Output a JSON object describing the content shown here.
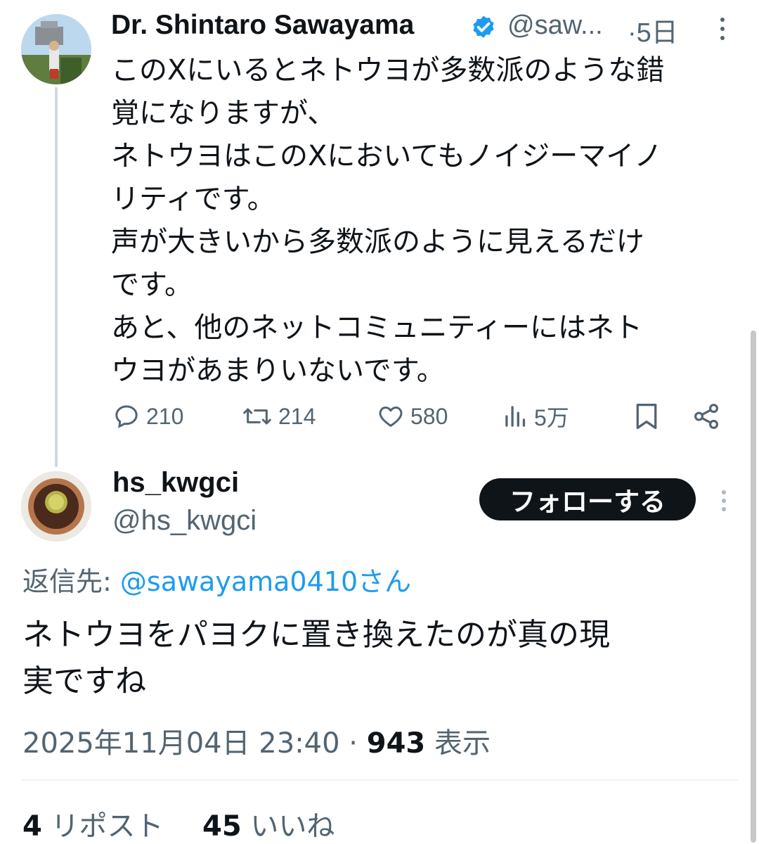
{
  "parent_tweet": {
    "author_name": "Dr. Shintaro Sawayama",
    "author_handle": "@saw...",
    "time_separator": "·",
    "time": "5日",
    "text_lines": [
      "このXにいるとネトウヨが多数派のような錯",
      "覚になりますが、",
      "ネトウヨはこのXにおいてもノイジーマイノ",
      "リティです。",
      "声が大きいから多数派のように見えるだけ",
      "です。",
      "あと、他のネットコミュニティーにはネト",
      "ウヨがあまりいないです。"
    ],
    "actions": {
      "replies": "210",
      "reposts": "214",
      "likes": "580",
      "views": "5万"
    },
    "icons": [
      "verified-badge-icon",
      "more-icon",
      "reply-icon",
      "repost-icon",
      "like-icon",
      "views-icon",
      "bookmark-icon",
      "share-icon"
    ]
  },
  "reply_tweet": {
    "author_name": "hs_kwgci",
    "author_handle": "@hs_kwgci",
    "follow_label": "フォローする",
    "reply_to_prefix": "返信先: ",
    "reply_to_handle": "@sawayama0410さん",
    "text_lines": [
      "ネトウヨをパヨクに置き換えたのが真の現",
      "実ですね"
    ],
    "timestamp": "2025年11月04日 23:40",
    "meta_separator": " · ",
    "view_count": "943",
    "view_label": " 表示",
    "repost_count": "4",
    "repost_label": " リポスト",
    "like_count": "45",
    "like_label": " いいね"
  },
  "colors": {
    "text": "#0f1419",
    "secondary": "#536471",
    "link": "#1d9bf0",
    "verified": "#1d9bf0",
    "divider": "#eff3f4"
  }
}
